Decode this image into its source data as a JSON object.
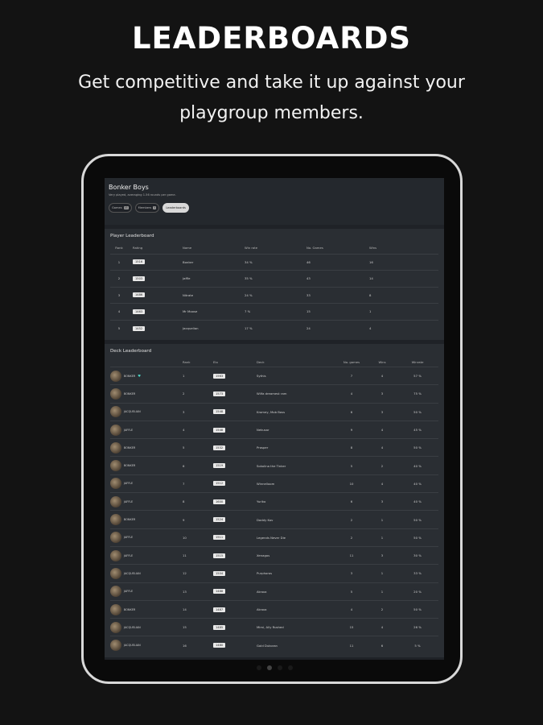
{
  "marketing": {
    "headline": "LEADERBOARDS",
    "subline": "Get competitive and take it up against your playgroup members."
  },
  "group": {
    "title": "Bonker Boys",
    "subtitle": "Very played, averaging 1.56 rounds per game.",
    "tabs": [
      {
        "label": "Games",
        "badge": "45",
        "active": false
      },
      {
        "label": "Members",
        "badge": "5",
        "active": false
      },
      {
        "label": "Leaderboards",
        "badge": "",
        "active": true
      }
    ]
  },
  "player_leaderboard": {
    "title": "Player Leaderboard",
    "columns": [
      "Rank",
      "Rating",
      "Name",
      "Win rate",
      "No. Games",
      "Wins"
    ],
    "rows": [
      {
        "rank": "1",
        "rating": "1516",
        "name": "Bonker",
        "win_rate": "34 %",
        "games": "46",
        "wins": "16"
      },
      {
        "rank": "2",
        "rating": "1503",
        "name": "Jaffle",
        "win_rate": "35 %",
        "games": "43",
        "wins": "14"
      },
      {
        "rank": "3",
        "rating": "1486",
        "name": "Nitrate",
        "win_rate": "24 %",
        "games": "33",
        "wins": "8"
      },
      {
        "rank": "4",
        "rating": "1463",
        "name": "Mr Moose",
        "win_rate": "7 %",
        "games": "15",
        "wins": "1"
      },
      {
        "rank": "5",
        "rating": "1452",
        "name": "Jacquelian",
        "win_rate": "17 %",
        "games": "24",
        "wins": "4"
      }
    ]
  },
  "deck_leaderboard": {
    "title": "Deck Leaderboard",
    "columns": [
      "",
      "Rank",
      "Elo",
      "Deck",
      "No. games",
      "Wins",
      "Winrate"
    ],
    "rows": [
      {
        "owner": "BONKER",
        "heart": true,
        "rank": "1",
        "elo": "1563",
        "deck": "Sythis",
        "games": "7",
        "wins": "4",
        "winrate": "57 %"
      },
      {
        "owner": "BONKER",
        "heart": false,
        "rank": "2",
        "elo": "1573",
        "deck": "Wilfa dreamest ram",
        "games": "4",
        "wins": "3",
        "winrate": "75 %"
      },
      {
        "owner": "JACQUELIAN",
        "heart": false,
        "rank": "3",
        "elo": "1548",
        "deck": "Kromey, Mob Boss",
        "games": "6",
        "wins": "3",
        "winrate": "50 %"
      },
      {
        "owner": "JAFFLE",
        "heart": false,
        "rank": "4",
        "elo": "1548",
        "deck": "Nekusar",
        "games": "9",
        "wins": "4",
        "winrate": "45 %"
      },
      {
        "owner": "BONKER",
        "heart": false,
        "rank": "5",
        "elo": "1532",
        "deck": "Prosper",
        "games": "8",
        "wins": "4",
        "winrate": "50 %"
      },
      {
        "owner": "BONKER",
        "heart": false,
        "rank": "6",
        "elo": "1519",
        "deck": "Sokolina the Tinker",
        "games": "5",
        "wins": "2",
        "winrate": "40 %"
      },
      {
        "owner": "JAFFLE",
        "heart": false,
        "rank": "7",
        "elo": "1512",
        "deck": "Winnelloom",
        "games": "10",
        "wins": "4",
        "winrate": "40 %"
      },
      {
        "owner": "JAFFLE",
        "heart": false,
        "rank": "8",
        "elo": "1600",
        "deck": "Yuriko",
        "games": "6",
        "wins": "3",
        "winrate": "40 %"
      },
      {
        "owner": "BONKER",
        "heart": false,
        "rank": "9",
        "elo": "1524",
        "deck": "Daddy Kov",
        "games": "2",
        "wins": "1",
        "winrate": "50 %"
      },
      {
        "owner": "JAFFLE",
        "heart": false,
        "rank": "10",
        "elo": "1511",
        "deck": "Legends Never Die",
        "games": "2",
        "wins": "1",
        "winrate": "50 %"
      },
      {
        "owner": "JAFFLE",
        "heart": false,
        "rank": "11",
        "elo": "1515",
        "deck": "Xenagos",
        "games": "11",
        "wins": "3",
        "winrate": "30 %"
      },
      {
        "owner": "JACQUELIAN",
        "heart": false,
        "rank": "12",
        "elo": "1504",
        "deck": "Purphoros",
        "games": "3",
        "wins": "1",
        "winrate": "33 %"
      },
      {
        "owner": "JAFFLE",
        "heart": false,
        "rank": "13",
        "elo": "1488",
        "deck": "Atraxa",
        "games": "5",
        "wins": "1",
        "winrate": "20 %"
      },
      {
        "owner": "BONKER",
        "heart": false,
        "rank": "14",
        "elo": "1487",
        "deck": "Atraxa",
        "games": "4",
        "wins": "2",
        "winrate": "50 %"
      },
      {
        "owner": "JACQUELIAN",
        "heart": false,
        "rank": "15",
        "elo": "1485",
        "deck": "Mimi, Ally Rushed",
        "games": "15",
        "wins": "4",
        "winrate": "26 %"
      },
      {
        "owner": "JACQUELIAN",
        "heart": false,
        "rank": "16",
        "elo": "1480",
        "deck": "Gold Dukoran",
        "games": "11",
        "wins": "6",
        "winrate": "5 %"
      }
    ]
  }
}
